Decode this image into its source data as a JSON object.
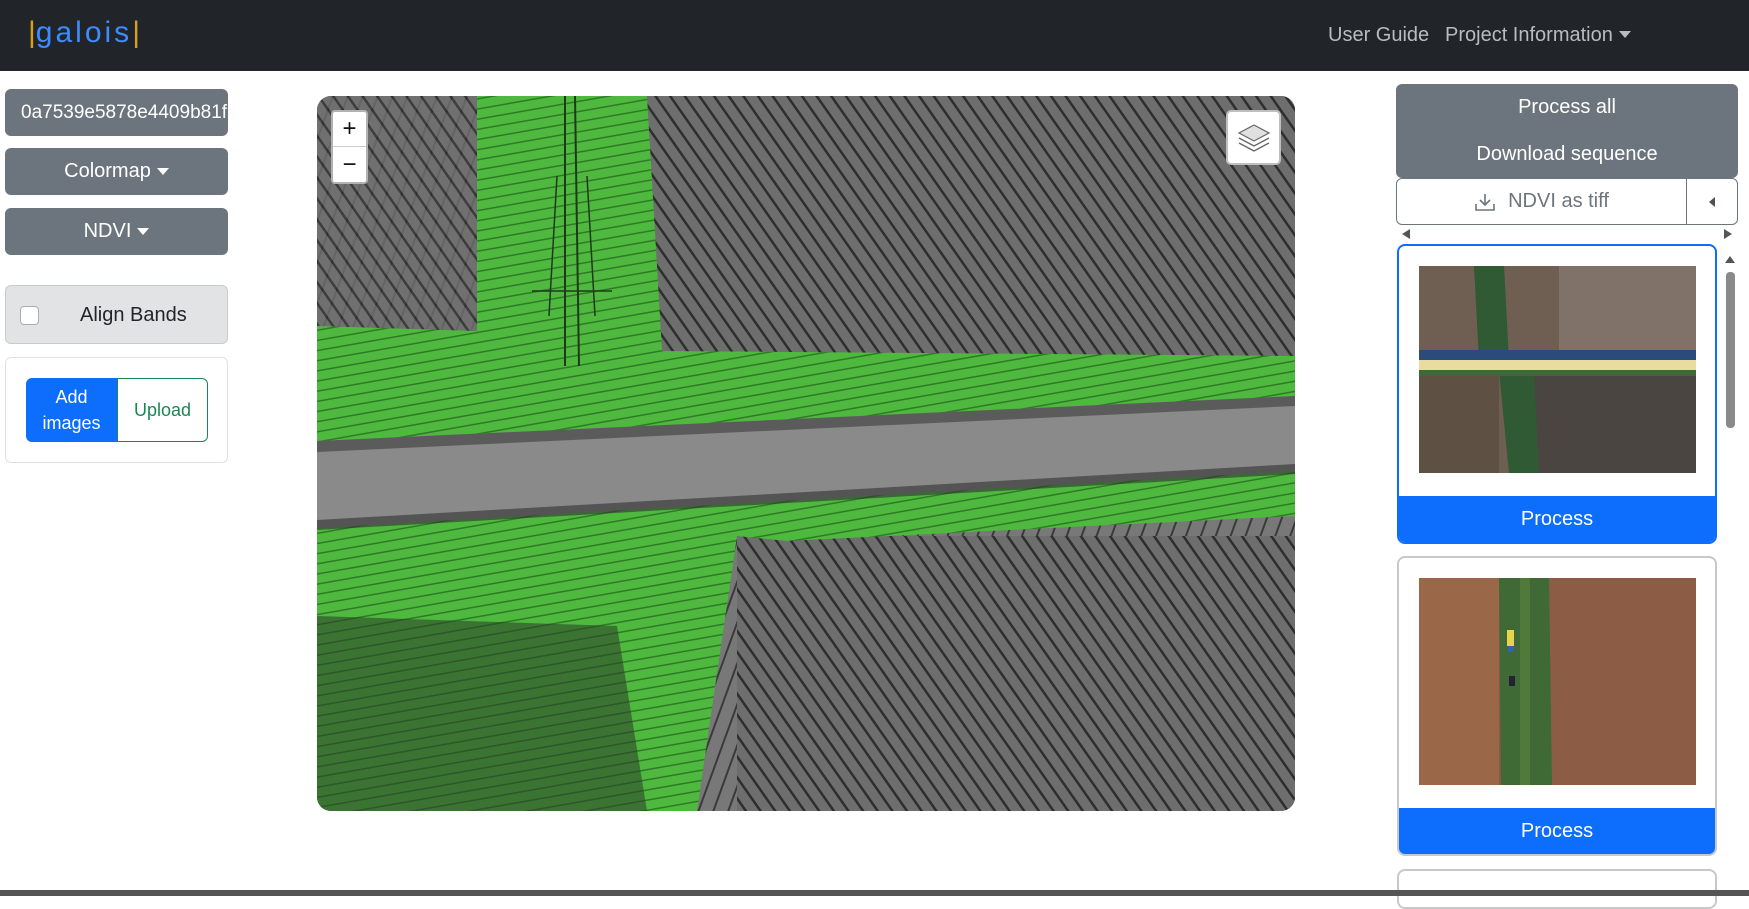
{
  "navbar": {
    "brand_text": "galois",
    "brand_bar": "|",
    "links": {
      "user_guide": "User Guide",
      "project_information": "Project Information"
    }
  },
  "sidebar": {
    "project_id": "0a7539e5878e4409b81f",
    "colormap_label": "Colormap",
    "index_label": "NDVI",
    "align_bands_label": "Align Bands",
    "align_bands_checked": false,
    "add_images_label": "Add images",
    "upload_label": "Upload"
  },
  "map": {
    "zoom_in": "+",
    "zoom_out": "−",
    "layers_icon": "layers-icon"
  },
  "right_panel": {
    "process_all_label": "Process all",
    "download_sequence_label": "Download sequence",
    "download_label": "NDVI as tiff",
    "download_icon": "download-icon",
    "cards": [
      {
        "process_label": "Process",
        "selected": true
      },
      {
        "process_label": "Process",
        "selected": false
      }
    ]
  },
  "colors": {
    "navbar_bg": "#212529",
    "secondary": "#6c757d",
    "primary": "#0d6efd",
    "success": "#198754",
    "ndvi_green": "#4fb83f"
  }
}
